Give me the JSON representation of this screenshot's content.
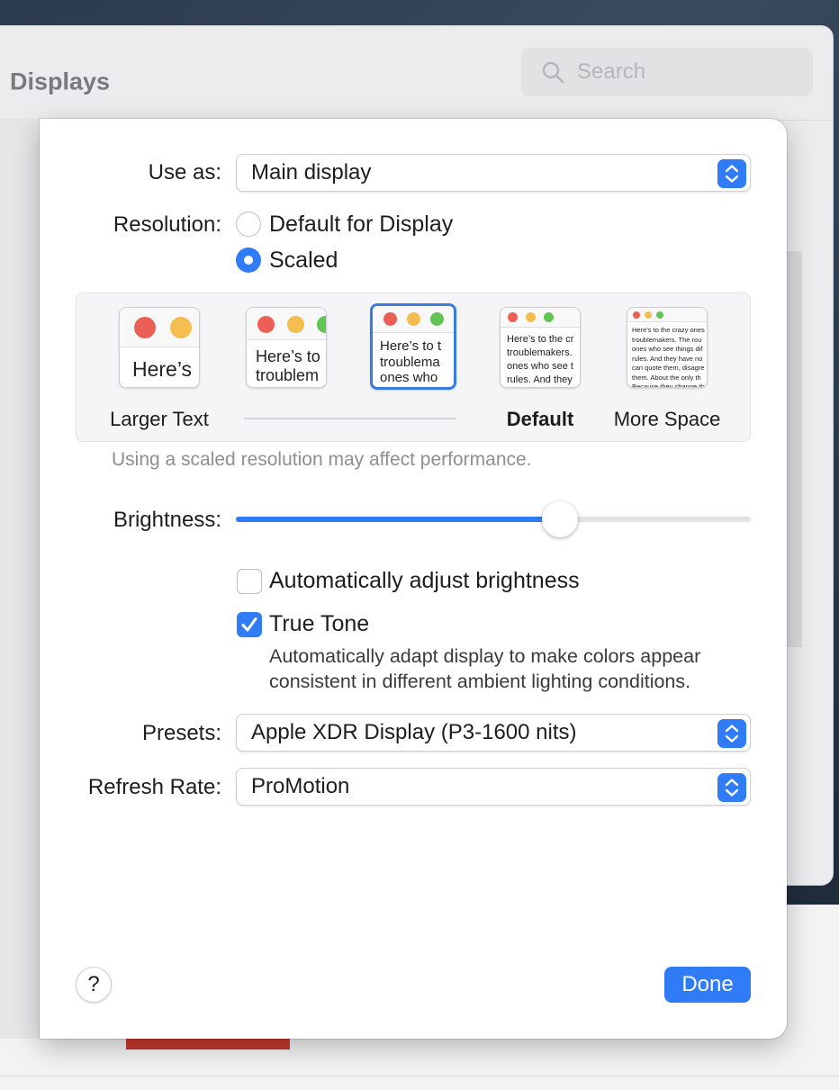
{
  "window": {
    "title": "Displays",
    "search_placeholder": "Search"
  },
  "sheet": {
    "use_as": {
      "label": "Use as:",
      "value": "Main display"
    },
    "resolution": {
      "label": "Resolution:",
      "options": [
        {
          "label": "Default for Display",
          "selected": false
        },
        {
          "label": "Scaled",
          "selected": true
        }
      ],
      "thumbnails": [
        {
          "label": "Larger Text",
          "text": "Here’s",
          "selected": false
        },
        {
          "label": "",
          "text": "Here’s to\ntroublem",
          "selected": false
        },
        {
          "label": "",
          "text": "Here’s to t\ntroublema\nones who",
          "selected": true
        },
        {
          "label": "Default",
          "text": "Here’s to the cr\ntroublemakers.\nones who see t\nrules. And they",
          "selected": false
        },
        {
          "label": "More Space",
          "text": "Here’s to the crazy ones\ntroublemakers. The rou\nones who see things dif\nrules. And they have no\ncan quote them, disagre\nthem. About the only th\nBecause they change th",
          "selected": false
        }
      ],
      "note": "Using a scaled resolution may affect performance."
    },
    "brightness": {
      "label": "Brightness:",
      "level_percent": 63
    },
    "auto_brightness": {
      "label": "Automatically adjust brightness",
      "checked": false
    },
    "true_tone": {
      "label": "True Tone",
      "checked": true,
      "description_line1": "Automatically adapt display to make colors appear",
      "description_line2": "consistent in different ambient lighting conditions."
    },
    "presets": {
      "label": "Presets:",
      "value": "Apple XDR Display (P3-1600 nits)"
    },
    "refresh_rate": {
      "label": "Refresh Rate:",
      "value": "ProMotion"
    },
    "help_label": "?",
    "done_label": "Done"
  },
  "colors": {
    "accent": "#2f7cf6",
    "traffic_red": "#ec5f57",
    "traffic_yellow": "#f4bd4f",
    "traffic_green": "#61c454"
  }
}
